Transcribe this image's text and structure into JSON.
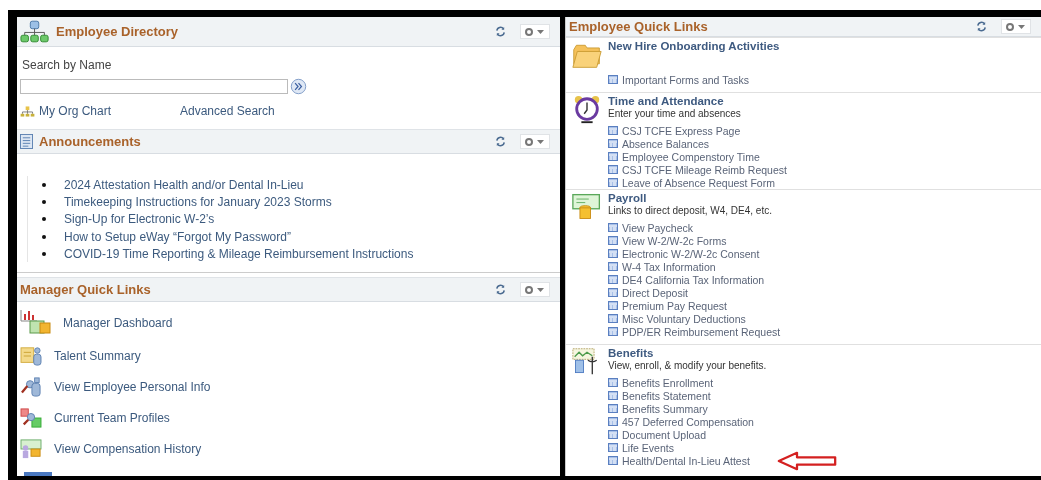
{
  "employee_directory": {
    "title": "Employee Directory",
    "search_label": "Search by Name",
    "links": [
      "My Org Chart",
      "Advanced Search"
    ]
  },
  "announcements": {
    "title": "Announcements",
    "items": [
      "2024 Attestation Health and/or Dental In-Lieu",
      "Timekeeping Instructions for January 2023 Storms",
      "Sign-Up for Electronic W-2’s",
      "How to Setup eWay “Forgot My Password”",
      "COVID-19 Time Reporting & Mileage Reimbursement Instructions"
    ]
  },
  "manager_quick_links": {
    "title": "Manager Quick Links",
    "items": [
      "Manager Dashboard",
      "Talent Summary",
      "View Employee Personal Info",
      "Current Team Profiles",
      "View Compensation History"
    ]
  },
  "employee_quick_links": {
    "title": "Employee Quick Links",
    "sections": [
      {
        "title": "New Hire Onboarding Activities",
        "links": [
          "Important Forms and Tasks"
        ]
      },
      {
        "title": "Time and Attendance",
        "subtitle": "Enter your time and absences",
        "links": [
          "CSJ TCFE Express Page",
          "Absence Balances",
          "Employee Compenstory Time",
          "CSJ TCFE Mileage Reimb Request",
          "Leave of Absence Request Form"
        ]
      },
      {
        "title": "Payroll",
        "subtitle": "Links to direct deposit, W4, DE4, etc.",
        "links": [
          "View Paycheck",
          "View W-2/W-2c Forms",
          "Electronic W-2/W-2c Consent",
          "W-4 Tax Information",
          "DE4 California Tax Information",
          "Direct Deposit",
          "Premium Pay Request",
          "Misc Voluntary Deductions",
          "PDP/ER Reimbursement Request"
        ]
      },
      {
        "title": "Benefits",
        "subtitle": "View, enroll, & modify your benefits.",
        "links": [
          "Benefits Enrollment",
          "Benefits Statement",
          "Benefits Summary",
          "457 Deferred Compensation",
          "Document Upload",
          "Life Events",
          "Health/Dental In-Lieu Attest"
        ]
      }
    ]
  }
}
